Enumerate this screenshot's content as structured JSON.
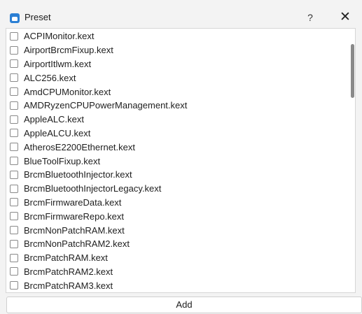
{
  "window": {
    "title": "Preset",
    "help_label": "?",
    "close_label": "✕"
  },
  "list": {
    "items": [
      {
        "label": "ACPIMonitor.kext",
        "checked": false
      },
      {
        "label": "AirportBrcmFixup.kext",
        "checked": false
      },
      {
        "label": "AirportItlwm.kext",
        "checked": false
      },
      {
        "label": "ALC256.kext",
        "checked": false
      },
      {
        "label": "AmdCPUMonitor.kext",
        "checked": false
      },
      {
        "label": "AMDRyzenCPUPowerManagement.kext",
        "checked": false
      },
      {
        "label": "AppleALC.kext",
        "checked": false
      },
      {
        "label": "AppleALCU.kext",
        "checked": false
      },
      {
        "label": "AtherosE2200Ethernet.kext",
        "checked": false
      },
      {
        "label": "BlueToolFixup.kext",
        "checked": false
      },
      {
        "label": "BrcmBluetoothInjector.kext",
        "checked": false
      },
      {
        "label": "BrcmBluetoothInjectorLegacy.kext",
        "checked": false
      },
      {
        "label": "BrcmFirmwareData.kext",
        "checked": false
      },
      {
        "label": "BrcmFirmwareRepo.kext",
        "checked": false
      },
      {
        "label": "BrcmNonPatchRAM.kext",
        "checked": false
      },
      {
        "label": "BrcmNonPatchRAM2.kext",
        "checked": false
      },
      {
        "label": "BrcmPatchRAM.kext",
        "checked": false
      },
      {
        "label": "BrcmPatchRAM2.kext",
        "checked": false
      },
      {
        "label": "BrcmPatchRAM3.kext",
        "checked": false
      }
    ]
  },
  "footer": {
    "add_label": "Add"
  },
  "colors": {
    "app_icon": "#2b7fd4",
    "background": "#f3f3f3",
    "list_background": "#ffffff"
  }
}
